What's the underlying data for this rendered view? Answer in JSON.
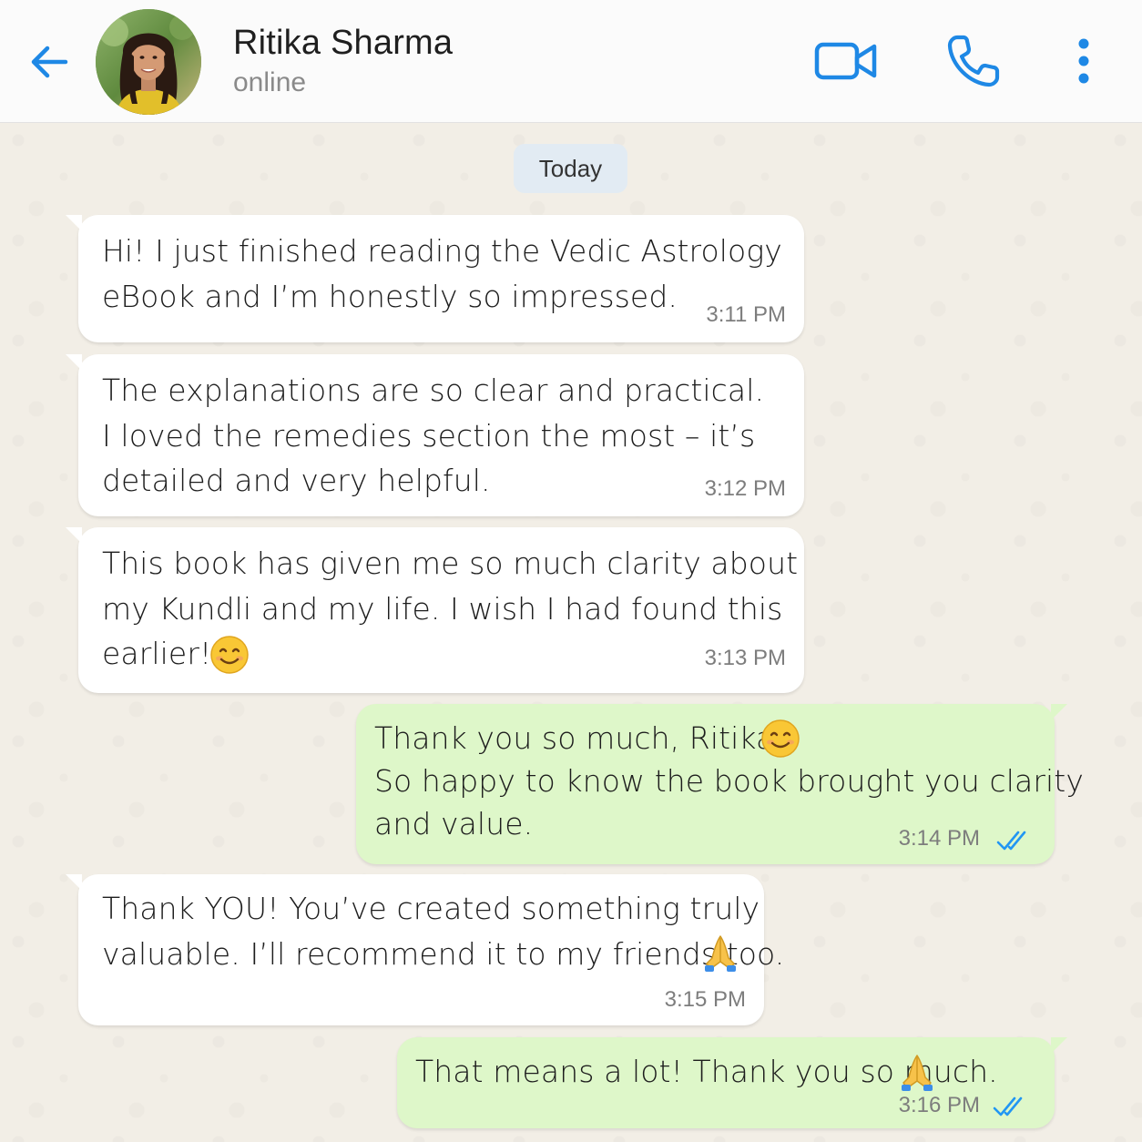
{
  "header": {
    "contact_name": "Ritika Sharma",
    "status": "online",
    "accent_color": "#1e88e5"
  },
  "date_divider": "Today",
  "messages": [
    {
      "direction": "incoming",
      "lines": [
        "Hi! I just finished reading the Vedic Astrology",
        "eBook and I’m honestly so impressed."
      ],
      "time": "3:11 PM"
    },
    {
      "direction": "incoming",
      "lines": [
        "The explanations are so clear and practical.",
        "I loved the remedies section the most – it’s",
        "detailed and very helpful."
      ],
      "time": "3:12 PM"
    },
    {
      "direction": "incoming",
      "lines": [
        "This book has given me so much clarity about",
        "my Kundli and my life. I wish I had found this",
        "earlier!"
      ],
      "emoji": "smiling-face-emoji",
      "time": "3:13 PM"
    },
    {
      "direction": "outgoing",
      "lines": [
        "Thank you so much, Ritika!",
        "So happy to know the book brought you clarity",
        "and value."
      ],
      "emoji": "smiling-face-emoji",
      "time": "3:14 PM",
      "status": "read"
    },
    {
      "direction": "incoming",
      "lines": [
        "Thank YOU! You’ve created something truly",
        "valuable. I’ll recommend it to my friends too."
      ],
      "emoji": "folded-hands-emoji",
      "time": "3:15 PM"
    },
    {
      "direction": "outgoing",
      "lines": [
        "That means a lot! Thank you so much."
      ],
      "emoji": "folded-hands-emoji",
      "time": "3:16 PM",
      "status": "read"
    }
  ],
  "icons": {
    "back": "arrow-left-icon",
    "video": "video-camera-icon",
    "call": "phone-icon",
    "menu": "more-vertical-icon",
    "read_receipt": "double-check-icon"
  }
}
